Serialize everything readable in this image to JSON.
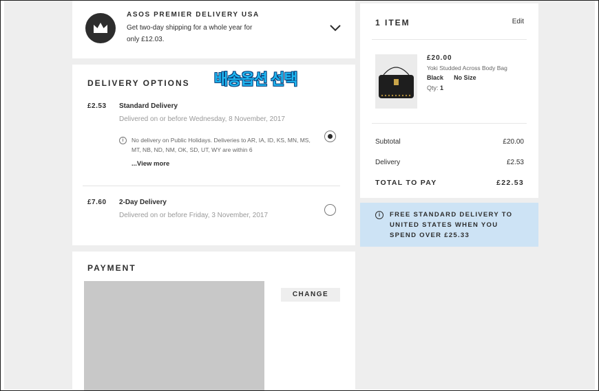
{
  "premier": {
    "title": "ASOS PREMIER DELIVERY USA",
    "text": "Get two-day shipping for a whole year for only £12.03.",
    "icon": "crown-icon",
    "toggle_icon": "chevron-down-icon"
  },
  "delivery": {
    "title": "DELIVERY OPTIONS",
    "annotation": "배송옵션 선택",
    "options": [
      {
        "price": "£2.53",
        "name": "Standard Delivery",
        "date": "Delivered on or before Wednesday, 8 November, 2017",
        "notice": "No delivery on Public Holidays. Deliveries to AR, IA, ID, KS, MN, MS, MT, NB, ND, NM, OK, SD, UT, WY are within 6",
        "view_more": "...View more",
        "selected": true
      },
      {
        "price": "£7.60",
        "name": "2-Day Delivery",
        "date": "Delivered on or before Friday, 3 November, 2017",
        "selected": false
      }
    ]
  },
  "payment": {
    "title": "PAYMENT",
    "change_label": "CHANGE"
  },
  "summary": {
    "title": "1 ITEM",
    "edit_label": "Edit",
    "product": {
      "price": "£20.00",
      "name": "Yoki Studded Across Body Bag",
      "color": "Black",
      "size": "No Size",
      "qty_label": "Qty:",
      "qty": "1"
    },
    "subtotal_label": "Subtotal",
    "subtotal_value": "£20.00",
    "delivery_label": "Delivery",
    "delivery_value": "£2.53",
    "total_label": "TOTAL TO PAY",
    "total_value": "£22.53"
  },
  "free_delivery": {
    "text": "FREE STANDARD DELIVERY TO UNITED STATES WHEN YOU SPEND OVER £25.33",
    "icon": "info-icon"
  },
  "colors": {
    "accent_blue": "#cde3f5",
    "annotation": "#1fb6f0",
    "text": "#2d2d2d"
  }
}
